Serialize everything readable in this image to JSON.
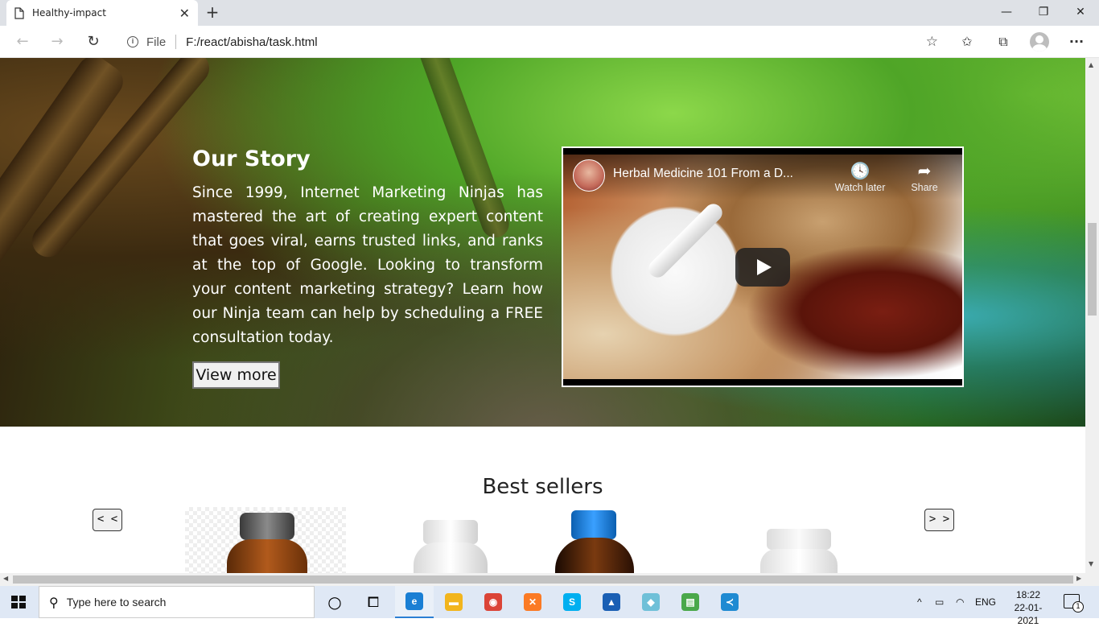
{
  "browser": {
    "tab_title": "Healthy-impact",
    "tab_close": "✕",
    "new_tab": "+",
    "window_controls": {
      "minimize": "—",
      "maximize": "❐",
      "close": "✕"
    },
    "nav": {
      "back": "←",
      "forward": "→",
      "refresh": "↻"
    },
    "address": {
      "info": "i",
      "scheme_label": "File",
      "url": "F:/react/abisha/task.html",
      "favorite": "☆"
    },
    "toolbar": {
      "favorites": "✩",
      "collections": "⧉",
      "more": "···"
    }
  },
  "hero": {
    "title": "Our Story",
    "text": "Since 1999, Internet Marketing Ninjas has mastered the art of creating expert content that goes viral, earns trusted links, and ranks at the top of Google. Looking to transform your content marketing strategy? Learn how our Ninja team can help by scheduling a FREE consultation today.",
    "button_label": "View more"
  },
  "video": {
    "title": "Herbal Medicine 101 From a D...",
    "watch_later_label": "Watch later",
    "watch_later_icon": "🕓",
    "share_label": "Share",
    "share_icon": "➦"
  },
  "best_sellers": {
    "title": "Best sellers",
    "prev_label": "< <",
    "next_label": "> >"
  },
  "scrollbars": {
    "up": "▲",
    "down": "▼",
    "left": "◀",
    "right": "▶"
  },
  "taskbar": {
    "search_icon": "⚲",
    "search_placeholder": "Type here to search",
    "cortana": "○",
    "task_view": "⧠",
    "apps": [
      {
        "name": "Microsoft Edge",
        "glyph": "e",
        "color": "#1a7fd4",
        "active": true
      },
      {
        "name": "File Explorer",
        "glyph": "▬",
        "color": "#f2b51d",
        "active": false
      },
      {
        "name": "Google Chrome",
        "glyph": "◉",
        "color": "#db4437",
        "active": false
      },
      {
        "name": "XAMPP",
        "glyph": "✕",
        "color": "#fb7a24",
        "active": false
      },
      {
        "name": "Skype",
        "glyph": "S",
        "color": "#00aff0",
        "active": false
      },
      {
        "name": "Photos",
        "glyph": "▲",
        "color": "#1a5fb4",
        "active": false
      },
      {
        "name": "Paint 3D",
        "glyph": "◆",
        "color": "#6fc0d8",
        "active": false
      },
      {
        "name": "Task Manager",
        "glyph": "▤",
        "color": "#4aa84a",
        "active": false
      },
      {
        "name": "Visual Studio Code",
        "glyph": "≺",
        "color": "#1f8ad2",
        "active": false
      }
    ],
    "tray": {
      "chevron": "^",
      "battery": "▭",
      "wifi": "◠",
      "language": "ENG",
      "time": "18:22",
      "date": "22-01-2021",
      "notification_count": "1"
    }
  }
}
